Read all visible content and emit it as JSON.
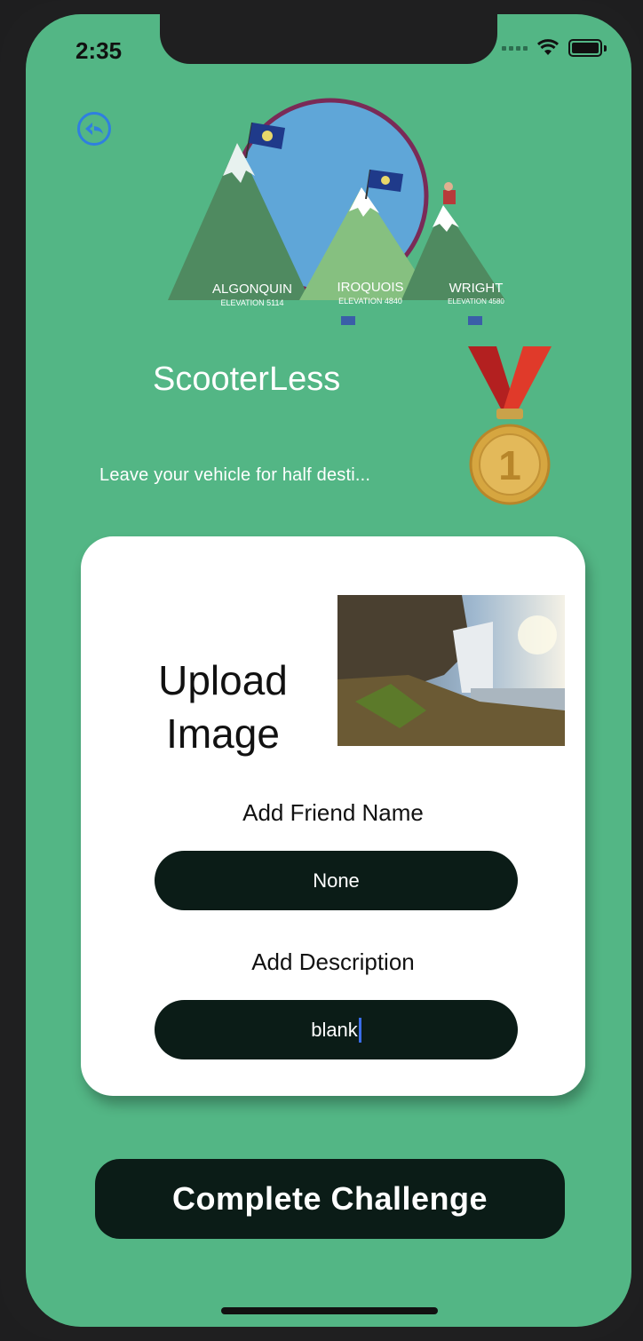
{
  "status_bar": {
    "time": "2:35"
  },
  "logo": {
    "mountains": [
      {
        "name": "ALGONQUIN",
        "elevation": "ELEVATION 5114"
      },
      {
        "name": "IROQUOIS",
        "elevation": "ELEVATION 4840"
      },
      {
        "name": "WRIGHT",
        "elevation": "ELEVATION 4580"
      }
    ]
  },
  "challenge": {
    "title": "ScooterLess",
    "description": "Leave your vehicle for half desti...",
    "medal_number": "1"
  },
  "form": {
    "upload_label": "Upload Image",
    "friend_label": "Add Friend Name",
    "friend_value": "None",
    "description_label": "Add Description",
    "description_value": "blank"
  },
  "actions": {
    "complete_label": "Complete Challenge"
  },
  "colors": {
    "background": "#53b685",
    "dark_pill": "#0b1c17",
    "back_icon": "#2f7fe0"
  }
}
